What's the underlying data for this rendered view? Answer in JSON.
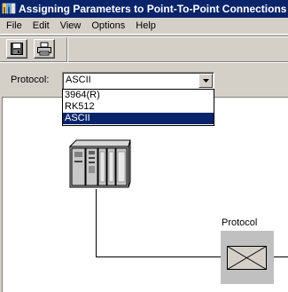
{
  "window": {
    "title": "Assigning Parameters to Point-To-Point Connections -"
  },
  "menubar": {
    "items": [
      {
        "label": "File"
      },
      {
        "label": "Edit"
      },
      {
        "label": "View"
      },
      {
        "label": "Options"
      },
      {
        "label": "Help"
      }
    ]
  },
  "toolbar": {
    "buttons": [
      {
        "icon": "save-icon"
      },
      {
        "icon": "print-icon"
      }
    ]
  },
  "protocol": {
    "label": "Protocol:",
    "selected": "ASCII",
    "options": [
      {
        "label": "3964(R)"
      },
      {
        "label": "RK512"
      },
      {
        "label": "ASCII"
      }
    ]
  },
  "diagram": {
    "protocol_label": "Protocol",
    "plc_icon": "plc-rack-icon",
    "protocol_icon": "envelope-icon"
  },
  "colors": {
    "titlebar": "#0a246a",
    "face": "#d4d0c8",
    "selection": "#0a246a",
    "protocol_box": "#c0c0c0"
  }
}
